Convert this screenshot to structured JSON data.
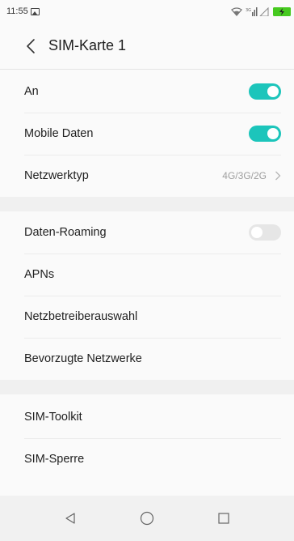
{
  "status_bar": {
    "time": "11:55",
    "icons": [
      "gallery-icon",
      "wifi-icon",
      "signal-icon",
      "battery-charging-icon"
    ],
    "battery_color": "#46c91f"
  },
  "header": {
    "title": "SIM-Karte 1",
    "back_icon": "chevron-left-icon"
  },
  "section1": {
    "items": [
      {
        "label": "An",
        "toggle": true
      },
      {
        "label": "Mobile Daten",
        "toggle": true
      },
      {
        "label": "Netzwerktyp",
        "value": "4G/3G/2G"
      }
    ]
  },
  "section2": {
    "items": [
      {
        "label": "Daten-Roaming",
        "toggle": false
      },
      {
        "label": "APNs"
      },
      {
        "label": "Netzbetreiberauswahl"
      },
      {
        "label": "Bevorzugte Netzwerke"
      }
    ]
  },
  "section3": {
    "items": [
      {
        "label": "SIM-Toolkit"
      },
      {
        "label": "SIM-Sperre"
      }
    ]
  },
  "nav_bar": {
    "icons": [
      "back-triangle-icon",
      "home-circle-icon",
      "recents-square-icon"
    ]
  },
  "colors": {
    "accent": "#1cc5bb",
    "toggle_off": "#e6e6e6",
    "divider": "#ececec",
    "section_gap": "#f0f0f0"
  }
}
